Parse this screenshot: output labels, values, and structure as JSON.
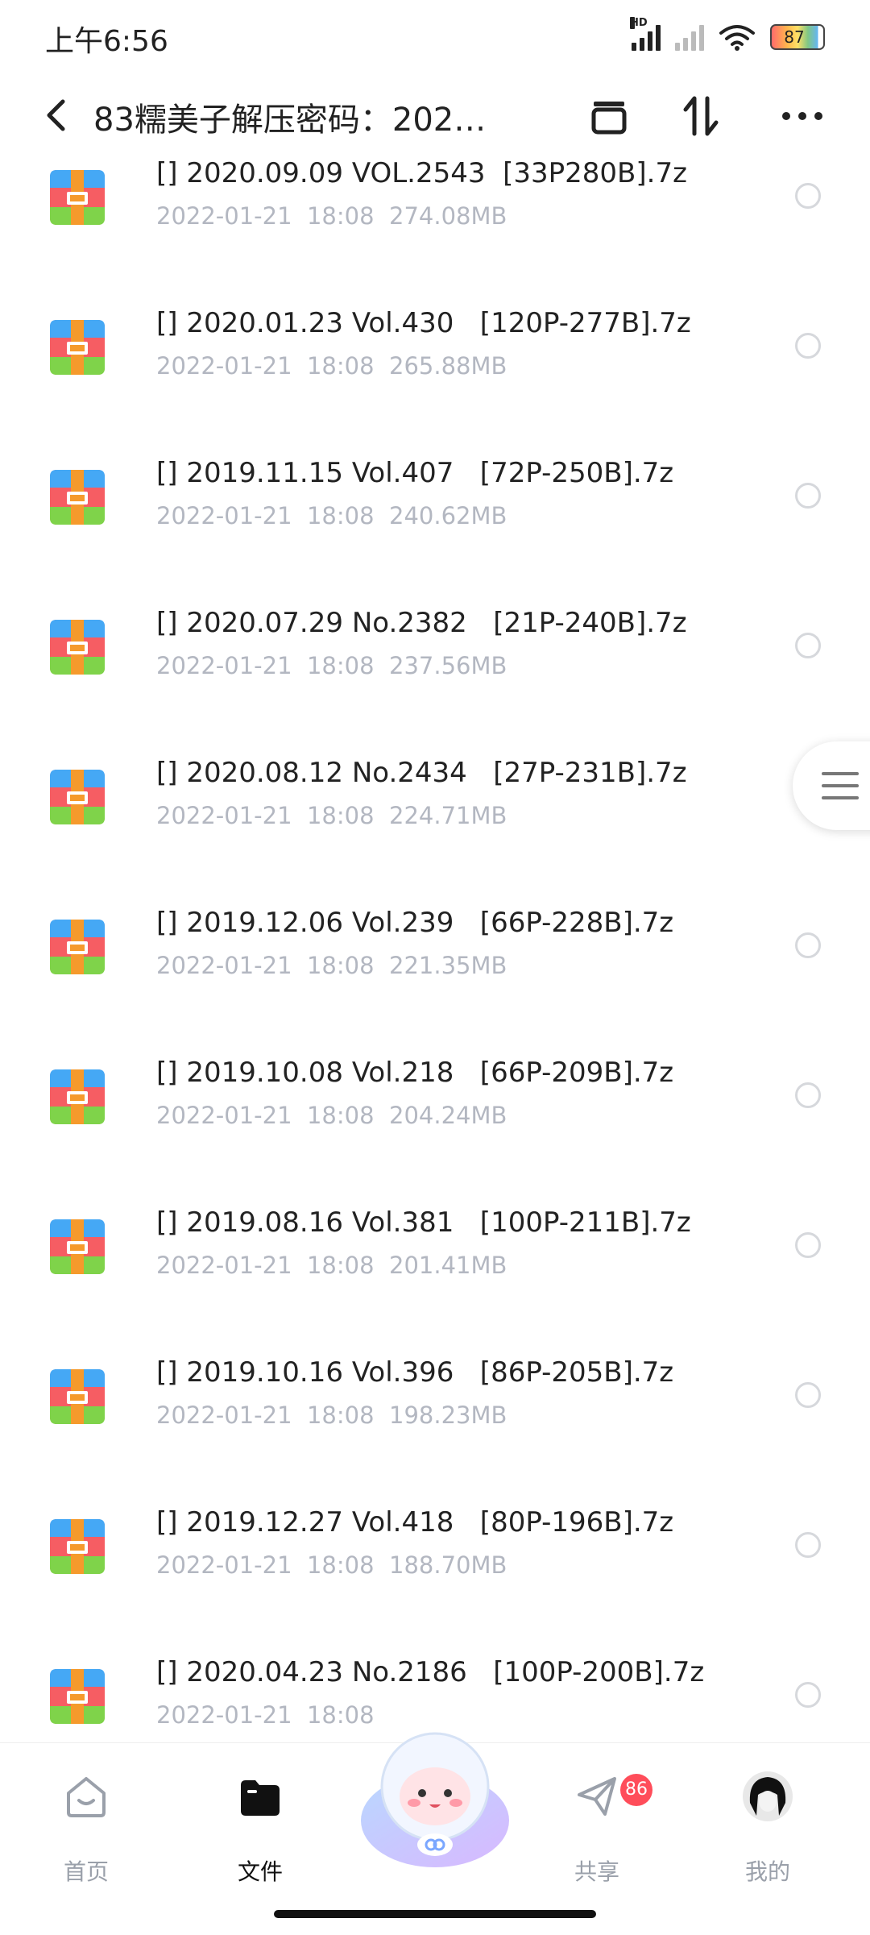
{
  "status_bar": {
    "time": "上午6:56",
    "hd": "HD",
    "battery": "87"
  },
  "header": {
    "title": "83糯美子解压密码：202…"
  },
  "files": [
    {
      "name": "[] 2020.09.09 VOL.2543  [33P280B].7z",
      "date": "2022-01-21",
      "time": "18:08",
      "size": "274.08MB"
    },
    {
      "name": "[] 2020.01.23 Vol.430   [120P-277B].7z",
      "date": "2022-01-21",
      "time": "18:08",
      "size": "265.88MB"
    },
    {
      "name": "[] 2019.11.15 Vol.407   [72P-250B].7z",
      "date": "2022-01-21",
      "time": "18:08",
      "size": "240.62MB"
    },
    {
      "name": "[] 2020.07.29 No.2382   [21P-240B].7z",
      "date": "2022-01-21",
      "time": "18:08",
      "size": "237.56MB"
    },
    {
      "name": "[] 2020.08.12 No.2434   [27P-231B].7z",
      "date": "2022-01-21",
      "time": "18:08",
      "size": "224.71MB"
    },
    {
      "name": "[] 2019.12.06 Vol.239   [66P-228B].7z",
      "date": "2022-01-21",
      "time": "18:08",
      "size": "221.35MB"
    },
    {
      "name": "[] 2019.10.08 Vol.218   [66P-209B].7z",
      "date": "2022-01-21",
      "time": "18:08",
      "size": "204.24MB"
    },
    {
      "name": "[] 2019.08.16 Vol.381   [100P-211B].7z",
      "date": "2022-01-21",
      "time": "18:08",
      "size": "201.41MB"
    },
    {
      "name": "[] 2019.10.16 Vol.396   [86P-205B].7z",
      "date": "2022-01-21",
      "time": "18:08",
      "size": "198.23MB"
    },
    {
      "name": "[] 2019.12.27 Vol.418   [80P-196B].7z",
      "date": "2022-01-21",
      "time": "18:08",
      "size": "188.70MB"
    },
    {
      "name": "[] 2020.04.23 No.2186   [100P-200B].7z",
      "date": "2022-01-21",
      "time": "18:08",
      "size": ""
    }
  ],
  "nav": [
    {
      "label": "首页",
      "icon": "home-icon",
      "active": false
    },
    {
      "label": "文件",
      "icon": "folder-icon",
      "active": true
    },
    {
      "label": "",
      "icon": "mascot-icon",
      "active": false
    },
    {
      "label": "共享",
      "icon": "share-plane-icon",
      "active": false,
      "badge": "86"
    },
    {
      "label": "我的",
      "icon": "avatar-icon",
      "active": false
    }
  ],
  "colors": {
    "meta_text": "#b3b7c1",
    "badge": "#ff4d5a",
    "zip_top": "#45a8f5",
    "zip_mid": "#f65d63",
    "zip_bottom": "#7fd34a",
    "zip_band": "#f59a2c"
  }
}
